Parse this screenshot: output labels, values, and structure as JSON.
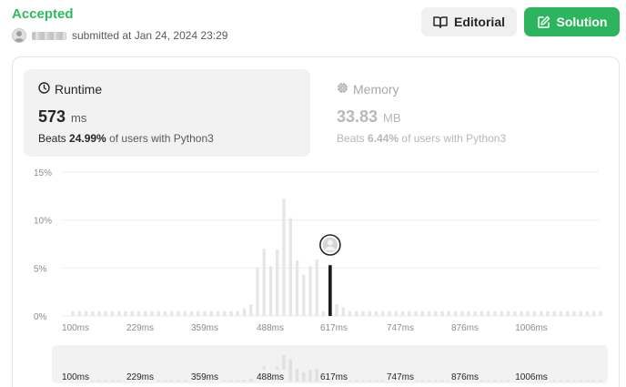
{
  "header": {
    "status": "Accepted",
    "submitted_text": "submitted at Jan 24, 2024 23:29",
    "editorial_label": "Editorial",
    "solution_label": "Solution"
  },
  "runtime": {
    "label": "Runtime",
    "value": "573",
    "unit": "ms",
    "beats_prefix": "Beats",
    "beats_pct": "24.99%",
    "beats_suffix": "of users with Python3"
  },
  "memory": {
    "label": "Memory",
    "value": "33.83",
    "unit": "MB",
    "beats_prefix": "Beats",
    "beats_pct": "6.44%",
    "beats_suffix": "of users with Python3"
  },
  "colors": {
    "accepted": "#2cbb5d",
    "solution_button": "#2db55d",
    "bar": "#e6e6e6",
    "highlight_bar": "#1a1a1a"
  },
  "chart_data": {
    "type": "bar",
    "ylabels": [
      "15%",
      "10%",
      "5%",
      "0%"
    ],
    "xlabels": [
      "100ms",
      "229ms",
      "359ms",
      "488ms",
      "617ms",
      "747ms",
      "876ms",
      "1006ms"
    ],
    "ylim": [
      0,
      15
    ],
    "grid": true,
    "highlight_value": "573 ms",
    "values": [
      0.5,
      0.5,
      0.5,
      0.5,
      0.5,
      0.5,
      0.5,
      0.5,
      0.5,
      0.5,
      0.5,
      0.5,
      0.5,
      0.5,
      0.5,
      0.5,
      0.5,
      0.5,
      0.5,
      0.5,
      0.5,
      0.5,
      0.5,
      0.5,
      0.5,
      0.5,
      0.8,
      1.2,
      5.0,
      7.0,
      5.2,
      6.9,
      12.2,
      10.2,
      5.8,
      4.3,
      5.2,
      5.9,
      0.5,
      5.3,
      1.2,
      0.9,
      0.5,
      0.5,
      0.5,
      0.5,
      0.5,
      0.5,
      0.5,
      0.5,
      0.5,
      0.5,
      0.5,
      0.5,
      0.5,
      0.5,
      0.5,
      0.5,
      0.5,
      0.5,
      0.5,
      0.5,
      0.5,
      0.5,
      0.5,
      0.5,
      0.5,
      0.5,
      0.5,
      0.5,
      0.5,
      0.5,
      0.5,
      0.5,
      0.5,
      0.5,
      0.5,
      0.5,
      0.5,
      0.5,
      0.5
    ],
    "highlight_index": 39
  }
}
